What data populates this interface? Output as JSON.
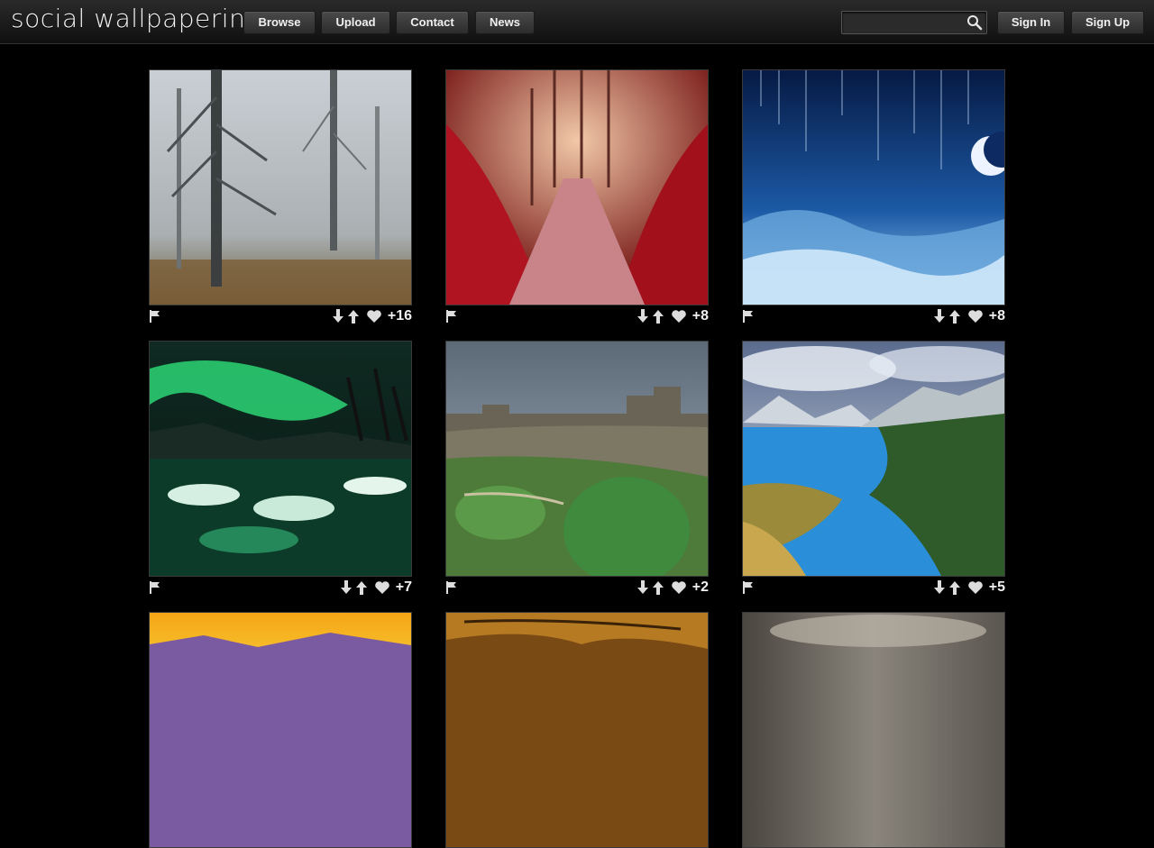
{
  "site": {
    "logo_text": "social wallpapering"
  },
  "nav": [
    {
      "label": "Browse"
    },
    {
      "label": "Upload"
    },
    {
      "label": "Contact"
    },
    {
      "label": "News"
    }
  ],
  "search": {
    "placeholder": "",
    "value": ""
  },
  "auth": {
    "sign_in": "Sign In",
    "sign_up": "Sign Up"
  },
  "wallpapers": [
    {
      "subject": "misty-forest",
      "score": "+16"
    },
    {
      "subject": "red-leaf-path",
      "score": "+8"
    },
    {
      "subject": "starry-night-moon",
      "score": "+8"
    },
    {
      "subject": "aurora-river",
      "score": "+7"
    },
    {
      "subject": "castle-on-hill",
      "score": "+2"
    },
    {
      "subject": "mountain-lake",
      "score": "+5"
    },
    {
      "subject": "sunset-mountains",
      "score": ""
    },
    {
      "subject": "autumn-trees",
      "score": ""
    },
    {
      "subject": "cloudy-sky",
      "score": ""
    }
  ],
  "colors": {
    "background": "#000000",
    "header": "#1c1c1c",
    "button": "#3a3a3a",
    "text": "#f0f0f0"
  }
}
